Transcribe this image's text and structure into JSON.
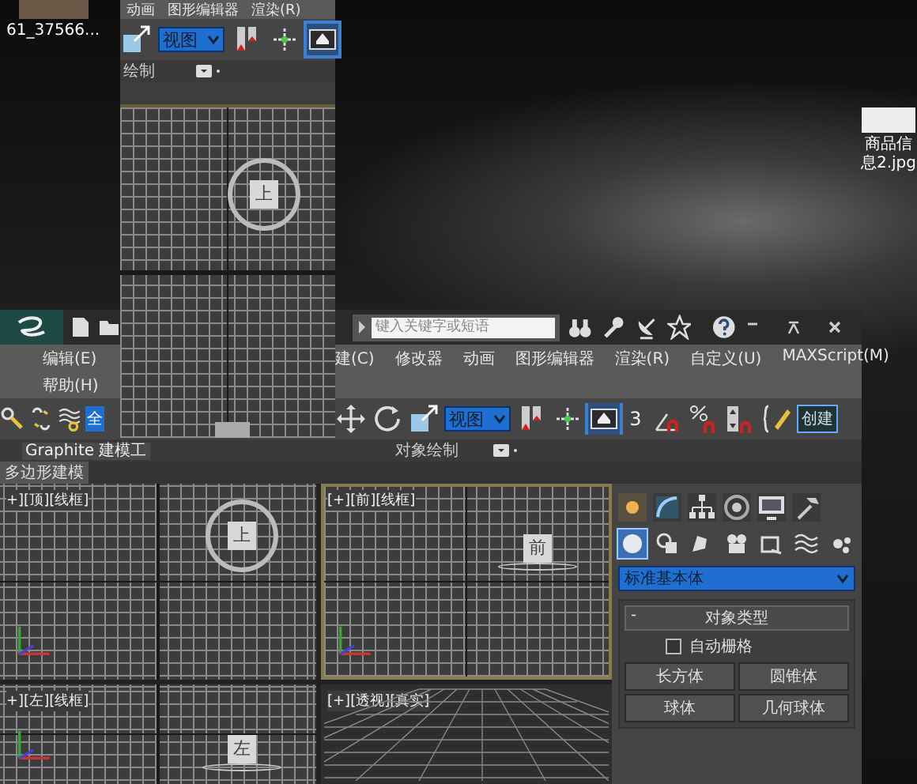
{
  "desktop_icons": [
    {
      "label": "61_37566..."
    },
    {
      "label": "商品信息2.jpg"
    }
  ],
  "main_window": {
    "search": {
      "placeholder": "键入关键字或短语"
    },
    "menu_left": [
      "编辑(E)",
      "帮助(H)"
    ],
    "menu_right": [
      "建(C)",
      "修改器",
      "动画",
      "图形编辑器",
      "渲染(R)",
      "自定义(U)",
      "MAXScript(M)"
    ],
    "selection_filter": "全",
    "tools": [
      {
        "kind": "move",
        "selected": false
      },
      {
        "kind": "rotate",
        "selected": false
      },
      {
        "kind": "scale",
        "selected": false
      },
      {
        "kind": "dropdown",
        "label": "视图",
        "selected": false
      },
      {
        "kind": "bookmark",
        "selected": false
      },
      {
        "kind": "axis",
        "selected": false
      },
      {
        "kind": "pivot",
        "selected": true
      },
      {
        "kind": "snap",
        "label": "3",
        "selected": false
      },
      {
        "kind": "angle-snap",
        "selected": false
      },
      {
        "kind": "percent-snap",
        "selected": false
      },
      {
        "kind": "spinner-snap",
        "selected": false
      },
      {
        "kind": "edit-set",
        "selected": false
      },
      {
        "kind": "field",
        "label": "创建",
        "selected": false
      }
    ],
    "ribbon_tabs": [
      {
        "label": "Graphite 建模工",
        "selected": true
      },
      {
        "label": "对象绘制",
        "selected": false
      }
    ],
    "ribbon_panel": "多边形建模",
    "viewports": [
      {
        "kind": "ortho",
        "label": "+][顶][线框]",
        "cube": "上",
        "ring": true,
        "active": false
      },
      {
        "kind": "ortho",
        "label": "[+][前][线框]",
        "cube": "前",
        "ring": false,
        "active": true
      },
      {
        "kind": "ortho",
        "label": "+][左][线框]",
        "cube": "左",
        "ring": false,
        "active": false
      },
      {
        "kind": "perspective",
        "label": "[+][透视][真实]",
        "active": false
      }
    ],
    "command_panel": {
      "tabs": [
        {
          "kind": "create",
          "selected": true
        },
        {
          "kind": "modify",
          "selected": false
        },
        {
          "kind": "hierarchy",
          "selected": false
        },
        {
          "kind": "motion",
          "selected": false
        },
        {
          "kind": "display",
          "selected": false
        },
        {
          "kind": "utilities",
          "selected": false
        }
      ],
      "categories": [
        {
          "kind": "geometry",
          "selected": true
        },
        {
          "kind": "shapes",
          "selected": false
        },
        {
          "kind": "lights",
          "selected": false
        },
        {
          "kind": "cameras",
          "selected": false
        },
        {
          "kind": "helpers",
          "selected": false
        },
        {
          "kind": "spacewarps",
          "selected": false
        },
        {
          "kind": "systems",
          "selected": false
        }
      ],
      "dropdown": "标准基本体",
      "rollout": {
        "collapse": "-",
        "title": "对象类型",
        "autogrid": {
          "label": "自动栅格",
          "checked": false
        },
        "buttons": [
          "长方体",
          "圆锥体",
          "球体",
          "几何球体"
        ]
      }
    }
  },
  "floating_window": {
    "menu": [
      "动画",
      "图形编辑器",
      "渲染(R)"
    ],
    "tools": [
      {
        "kind": "scale",
        "selected": false
      },
      {
        "kind": "dropdown",
        "label": "视图",
        "selected": false
      },
      {
        "kind": "bookmark",
        "selected": false
      },
      {
        "kind": "axis",
        "selected": false
      },
      {
        "kind": "pivot",
        "selected": true
      }
    ],
    "ribbon_label": "绘制",
    "cube": "上"
  }
}
